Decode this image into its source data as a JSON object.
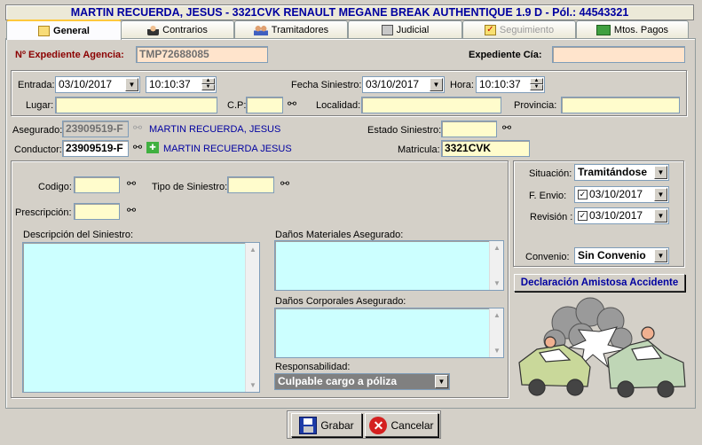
{
  "title": "MARTIN RECUERDA, JESUS - 3321CVK RENAULT MEGANE BREAK AUTHENTIQUE 1.9 D - Pól.: 44543321",
  "tabs": [
    {
      "label": "General",
      "icon": "folder-icon"
    },
    {
      "label": "Contrarios",
      "icon": "spy-icon"
    },
    {
      "label": "Tramitadores",
      "icon": "people-icon"
    },
    {
      "label": "Judicial",
      "icon": "judge-icon"
    },
    {
      "label": "Seguimiento",
      "icon": "checklist-icon"
    },
    {
      "label": "Mtos. Pagos",
      "icon": "money-icon"
    }
  ],
  "expediente": {
    "agencia_label": "Nº Expediente Agencia:",
    "agencia_value": "TMP72688085",
    "cia_label": "Expediente Cía:",
    "cia_value": ""
  },
  "siniestro": {
    "entrada_label": "Entrada:",
    "entrada_date": "03/10/2017",
    "entrada_time": "10:10:37",
    "fecha_label": "Fecha Siniestro:",
    "fecha_date": "03/10/2017",
    "hora_label": "Hora:",
    "hora_time": "10:10:37",
    "lugar_label": "Lugar:",
    "lugar_value": "",
    "cp_label": "C.P:",
    "cp_value": "",
    "localidad_label": "Localidad:",
    "localidad_value": "",
    "provincia_label": "Provincia:",
    "provincia_value": ""
  },
  "personas": {
    "asegurado_label": "Asegurado:",
    "asegurado_id": "23909519-F",
    "asegurado_name": "MARTIN RECUERDA, JESUS",
    "conductor_label": "Conductor:",
    "conductor_id": "23909519-F",
    "conductor_name": "MARTIN RECUERDA JESUS",
    "estado_label": "Estado Siniestro:",
    "estado_value": "",
    "matricula_label": "Matricula:",
    "matricula_value": "3321CVK"
  },
  "detalle": {
    "codigo_label": "Codigo:",
    "codigo_value": "",
    "tipo_label": "Tipo de Siniestro:",
    "tipo_value": "",
    "prescripcion_label": "Prescripción:",
    "prescripcion_value": "",
    "descripcion_label": "Descripción del Siniestro:",
    "danos_mat_label": "Daños Materiales Asegurado:",
    "danos_corp_label": "Daños Corporales Asegurado:",
    "responsabilidad_label": "Responsabilidad:",
    "responsabilidad_value": "Culpable cargo a póliza"
  },
  "estado_panel": {
    "situacion_label": "Situación:",
    "situacion_value": "Tramitándose",
    "envio_label": "F.  Envio:",
    "envio_value": "03/10/2017",
    "revision_label": "Revisión :",
    "revision_value": "03/10/2017",
    "convenio_label": "Convenio:",
    "convenio_value": "Sin Convenio",
    "declaracion_button": "Declaración Amistosa Accidente"
  },
  "footer": {
    "grabar_label": "Grabar",
    "cancelar_label": "Cancelar"
  }
}
